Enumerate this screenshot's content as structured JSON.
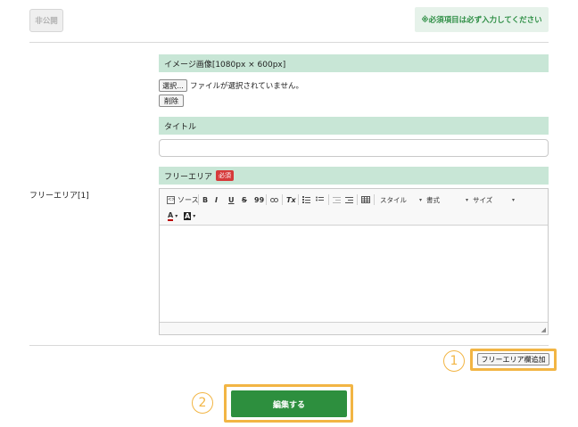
{
  "header": {
    "private_button": "非公開",
    "required_notice": "※必須項目は必ず入力してください"
  },
  "row": {
    "label": "フリーエリア[1]"
  },
  "image_section": {
    "heading": "イメージ画像[1080px × 600px]",
    "choose_button": "選択...",
    "file_status": "ファイルが選択されていません。",
    "delete_button": "削除"
  },
  "title_section": {
    "heading": "タイトル",
    "value": ""
  },
  "free_area_section": {
    "heading": "フリーエリア",
    "required_badge": "必須"
  },
  "toolbar": {
    "source_label": "ソース",
    "bold": "B",
    "italic": "I",
    "underline": "U",
    "strike": "S",
    "quote": "99",
    "clear_format": "Tx",
    "style_combo": "スタイル",
    "format_combo": "書式",
    "size_combo": "サイズ",
    "text_color": "A",
    "bg_color": "A"
  },
  "actions": {
    "add_free_area": "フリーエリア欄追加",
    "submit": "編集する"
  },
  "callouts": {
    "one": "1",
    "two": "2"
  },
  "colors": {
    "accent_green": "#2d8f3e",
    "section_header": "#c8e6d6",
    "highlight": "#f2b544",
    "required_red": "#d63a3a"
  }
}
